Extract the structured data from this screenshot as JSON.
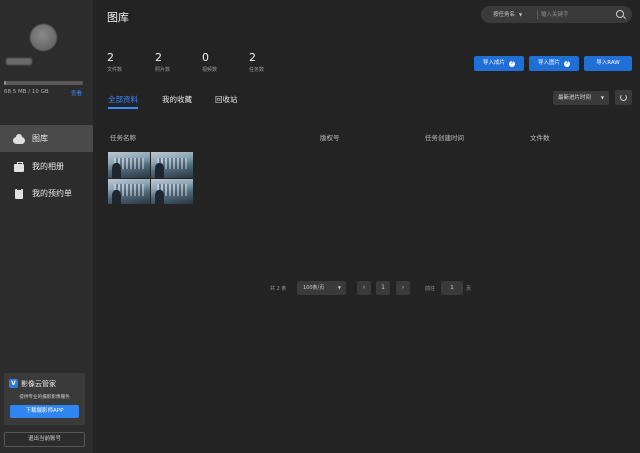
{
  "sidebar": {
    "storage_text": "68.5 MB / 10 GB",
    "storage_used_fraction": 0.0067,
    "storage_link": "查看",
    "nav": [
      {
        "label": "图库",
        "icon": "cloud-icon",
        "active": true
      },
      {
        "label": "我的相册",
        "icon": "briefcase-icon",
        "active": false
      },
      {
        "label": "我的预约单",
        "icon": "clipboard-icon",
        "active": false
      }
    ],
    "promo": {
      "logo_letter": "V",
      "title": "影像云管家",
      "subtitle": "提供专业的摄影影像服务",
      "button": "下载摄影师APP"
    },
    "logout": "退出当前账号"
  },
  "header": {
    "title": "图库",
    "search": {
      "type_label": "按任务名",
      "placeholder": "输入关键字"
    }
  },
  "stats": [
    {
      "value": "2",
      "label": "文件数"
    },
    {
      "value": "2",
      "label": "照片数"
    },
    {
      "value": "0",
      "label": "视频数"
    },
    {
      "value": "2",
      "label": "任务数"
    }
  ],
  "actions": {
    "import_album": "导入成片",
    "import_photo": "导入图片",
    "import_raw": "导入RAW",
    "help_glyph": "?"
  },
  "tabs": [
    {
      "label": "全部资料",
      "active": true
    },
    {
      "label": "我的收藏",
      "active": false
    },
    {
      "label": "回收站",
      "active": false
    }
  ],
  "sort": {
    "selected": "最新进片时间"
  },
  "table": {
    "columns": [
      "任务名称",
      "版权号",
      "任务创建时间",
      "文件数"
    ]
  },
  "pagination": {
    "total": "共 2 条",
    "page_size": "100条/页",
    "prev": "‹",
    "current": "1",
    "next": "›",
    "goto_label": "前往",
    "goto_value": "1",
    "goto_unit": "页"
  },
  "colors": {
    "accent": "#3d8bfd",
    "button": "#1f6fd6",
    "background": "#232323",
    "sidebar": "#2c2c2c"
  }
}
